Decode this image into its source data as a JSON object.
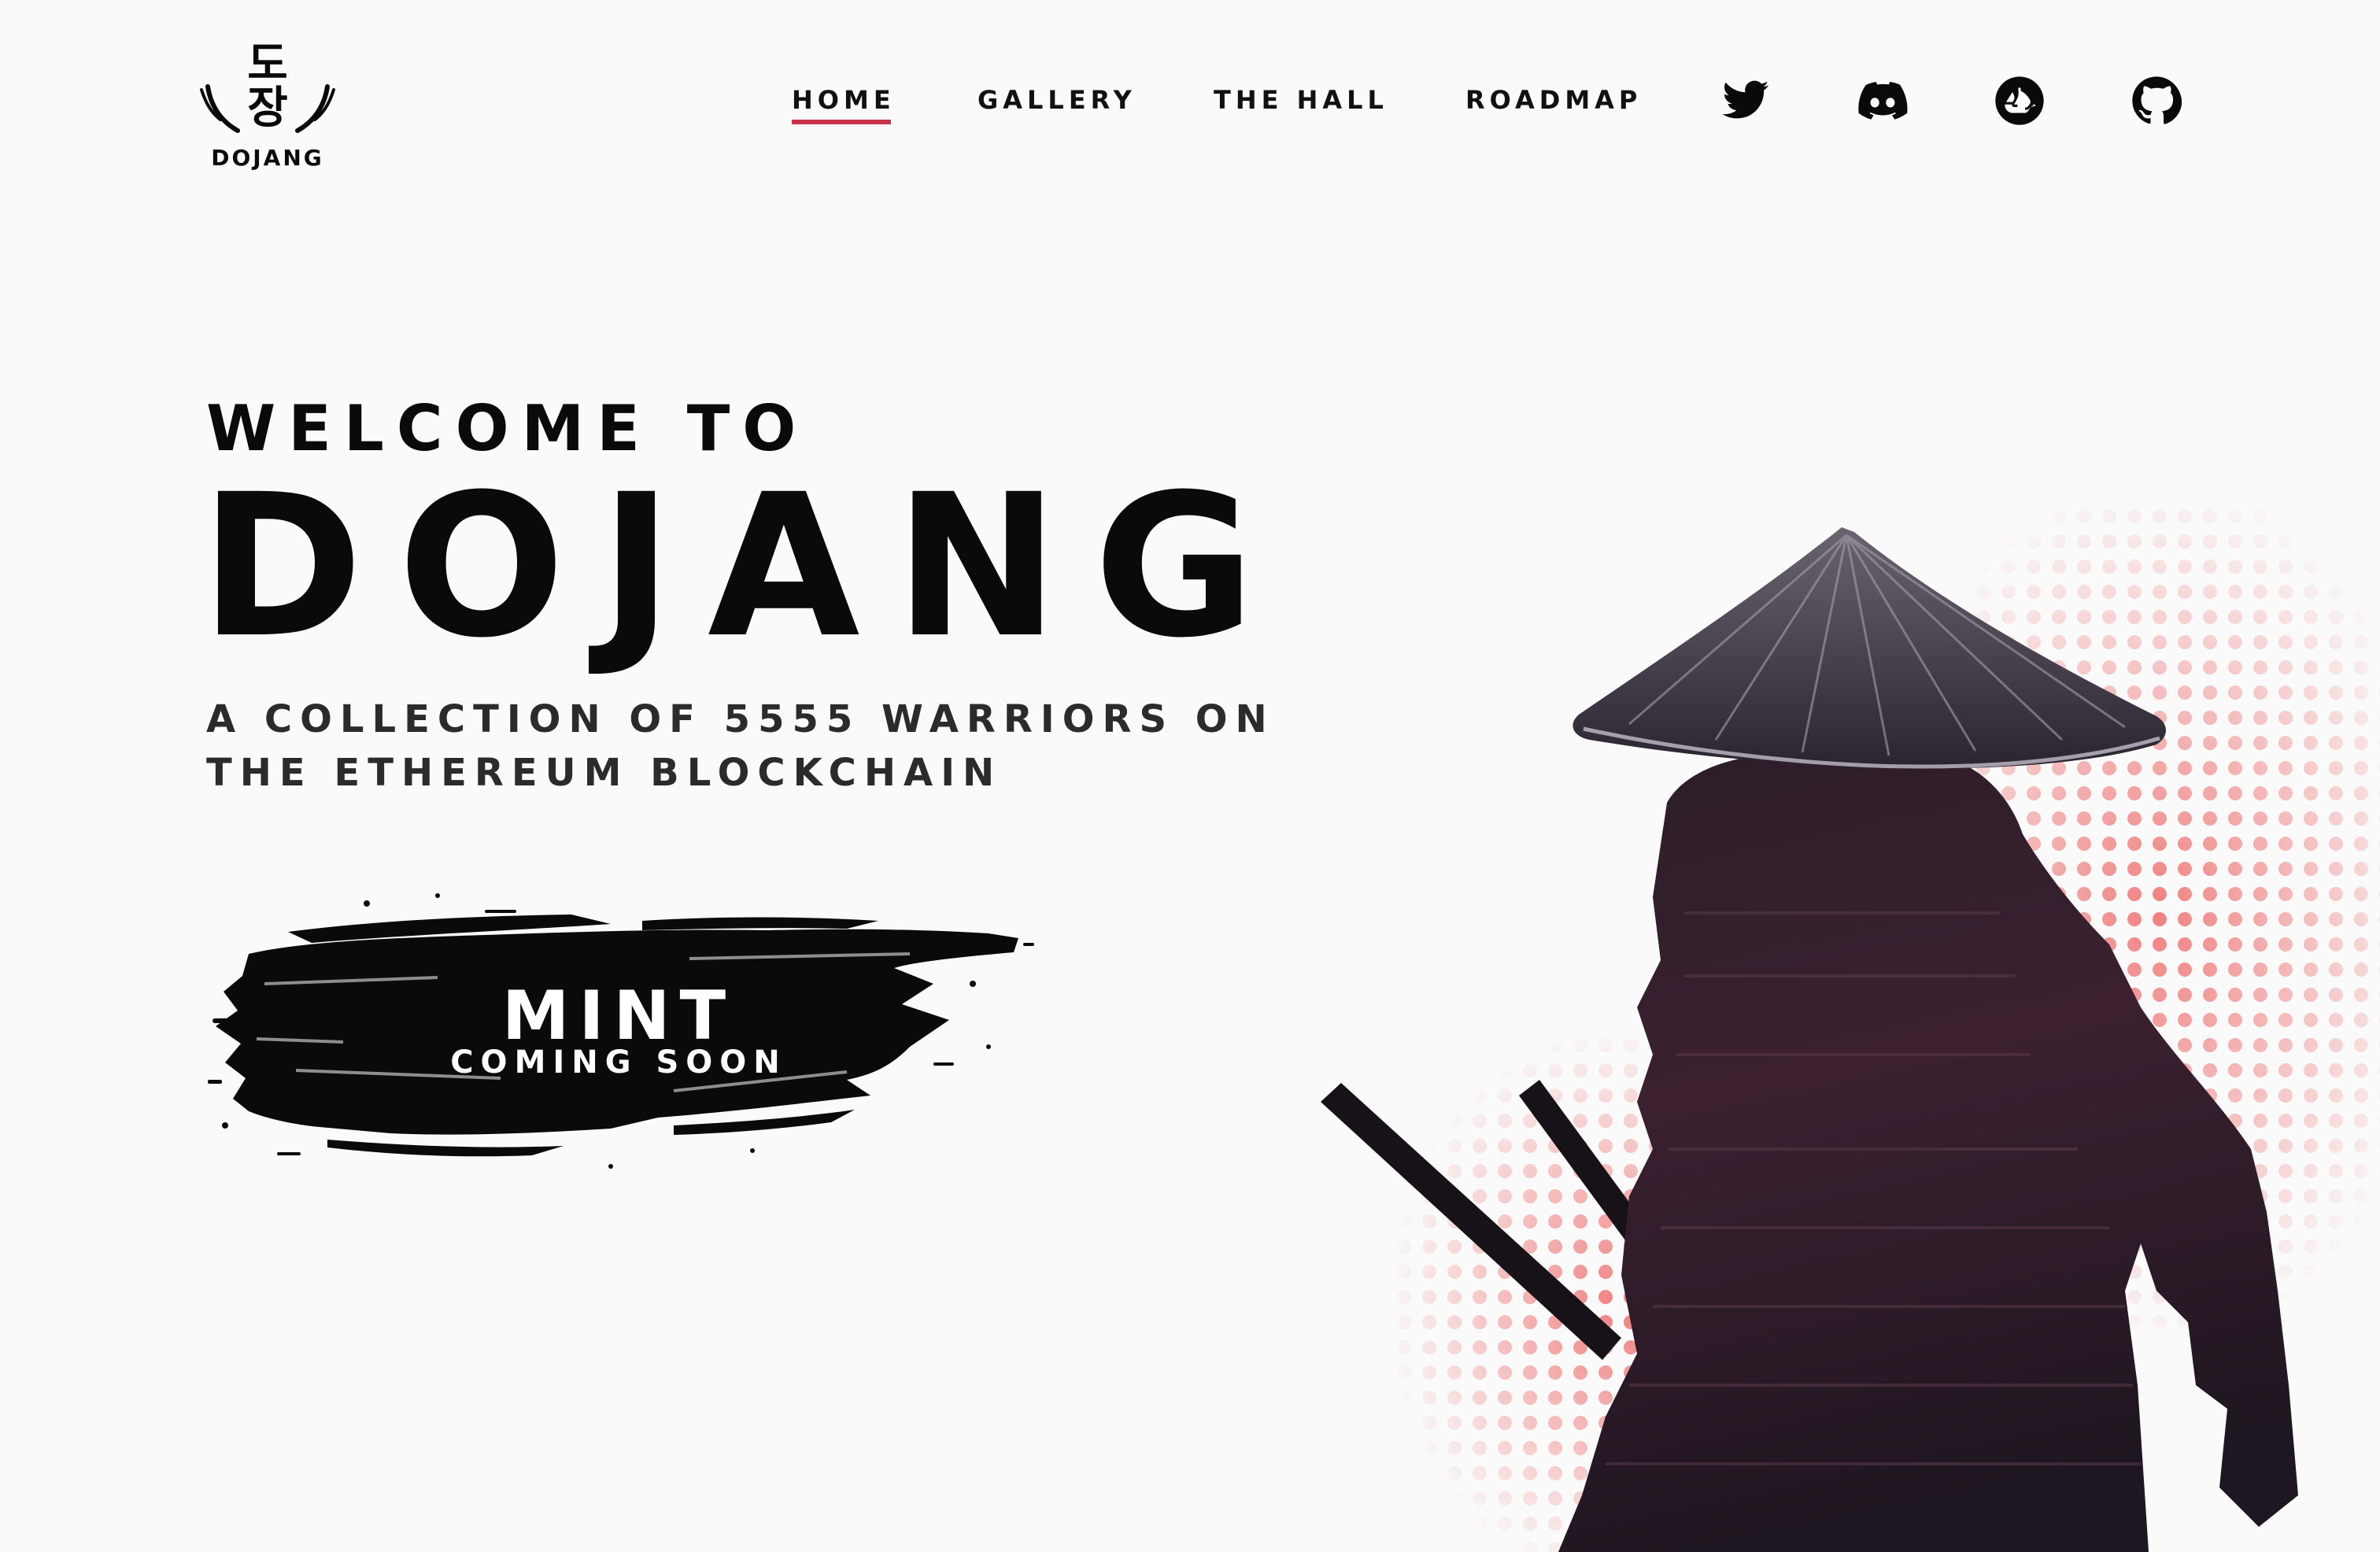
{
  "header": {
    "logo": {
      "hangul_top": "도",
      "hangul_bottom": "장",
      "text": "DOJANG"
    },
    "nav": [
      {
        "label": "HOME",
        "active": true
      },
      {
        "label": "GALLERY",
        "active": false
      },
      {
        "label": "THE HALL",
        "active": false
      },
      {
        "label": "ROADMAP",
        "active": false
      }
    ],
    "social": [
      {
        "icon": "twitter-icon"
      },
      {
        "icon": "discord-icon"
      },
      {
        "icon": "opensea-icon"
      },
      {
        "icon": "github-icon"
      }
    ]
  },
  "hero": {
    "pre_title": "WELCOME TO",
    "title": "DOJANG",
    "subtitle_line1": "A COLLECTION OF 5555 WARRIORS ON",
    "subtitle_line2": "THE ETHEREUM BLOCKCHAIN"
  },
  "mint": {
    "label": "MINT",
    "sublabel": "COMING SOON"
  },
  "colors": {
    "background": "#fafafa",
    "text": "#0a0a0a",
    "accent": "#c8324a",
    "halftone": "#f08080",
    "samurai_dark": "#1c1420",
    "samurai_mid": "#3a2232"
  }
}
